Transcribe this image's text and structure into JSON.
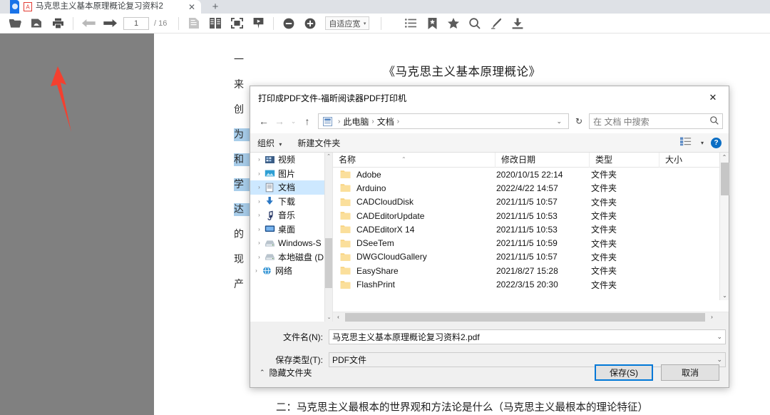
{
  "browser": {
    "tab": {
      "title": "马克思主义基本原理概论复习资料2",
      "favicon": "pdf-file-icon",
      "close_label": "✕"
    },
    "new_tab_label": "+"
  },
  "reader_toolbar": {
    "buttons": [
      {
        "name": "open-file-icon",
        "label": "open"
      },
      {
        "name": "cloud-open-icon",
        "label": "cloud"
      },
      {
        "name": "print-icon",
        "label": "print"
      },
      {
        "name": "previous-page-icon",
        "label": "prev"
      },
      {
        "name": "next-page-icon",
        "label": "next"
      }
    ],
    "page_number": "1",
    "page_total": "/ 16",
    "view_buttons": [
      {
        "name": "single-page-icon",
        "label": "single"
      },
      {
        "name": "two-page-icon",
        "label": "double"
      },
      {
        "name": "fit-page-icon",
        "label": "fit"
      },
      {
        "name": "presentation-icon",
        "label": "present"
      }
    ],
    "zoom_out_label": "−",
    "zoom_in_label": "+",
    "zoom_level": "自适应宽",
    "zoom_caret": "▾",
    "right_buttons": [
      {
        "name": "outline-list-icon",
        "label": "outline"
      },
      {
        "name": "bookmark-icon",
        "label": "bookmark"
      },
      {
        "name": "favorite-star-icon",
        "label": "star"
      },
      {
        "name": "search-icon",
        "label": "search"
      },
      {
        "name": "highlight-pen-icon",
        "label": "highlight"
      },
      {
        "name": "download-icon",
        "label": "download"
      }
    ]
  },
  "pdf_page": {
    "title": "《马克思主义基本原理概论》",
    "bottom_heading": "二：马克思主义最根本的世界观和方法论是什么（马克思主义最根本的理论特征）",
    "edge_chars": [
      {
        "char": "一",
        "highlighted": false
      },
      {
        "char": "来",
        "highlighted": false
      },
      {
        "char": "创",
        "highlighted": false
      },
      {
        "char": "为",
        "highlighted": true
      },
      {
        "char": "和",
        "highlighted": true
      },
      {
        "char": "学",
        "highlighted": true
      },
      {
        "char": "达",
        "highlighted": true
      },
      {
        "char": "的",
        "highlighted": false
      },
      {
        "char": "现",
        "highlighted": false
      },
      {
        "char": "产",
        "highlighted": false
      }
    ]
  },
  "annotation": {
    "arrow_color": "#f4402f",
    "name": "red-pointer-arrow"
  },
  "save_dialog": {
    "title": "打印成PDF文件-福昕阅读器PDF打印机",
    "close_label": "✕",
    "nav": {
      "back_label": "←",
      "forward_label": "→",
      "recent_label": "⌄",
      "up_label": "↑",
      "address_icon": "folder-location-icon",
      "breadcrumbs": [
        "此电脑",
        "文档"
      ],
      "separator": "›",
      "address_caret": "⌄",
      "refresh_label": "↻",
      "search_placeholder": "在 文档 中搜索",
      "search_icon": "search-icon"
    },
    "command_bar": {
      "organize_label": "组织",
      "organize_caret": "▾",
      "new_folder_label": "新建文件夹",
      "view_icon": "view-options-icon",
      "view_caret": "▾",
      "help_label": "?"
    },
    "tree": {
      "items": [
        {
          "label": "视频",
          "icon": "video-folder-icon",
          "selected": false,
          "expander": "›"
        },
        {
          "label": "图片",
          "icon": "pictures-folder-icon",
          "selected": false,
          "expander": "›"
        },
        {
          "label": "文档",
          "icon": "documents-folder-icon",
          "selected": true,
          "expander": "›"
        },
        {
          "label": "下载",
          "icon": "downloads-folder-icon",
          "selected": false,
          "expander": "›"
        },
        {
          "label": "音乐",
          "icon": "music-folder-icon",
          "selected": false,
          "expander": "›"
        },
        {
          "label": "桌面",
          "icon": "desktop-folder-icon",
          "selected": false,
          "expander": "›"
        },
        {
          "label": "Windows-S",
          "icon": "local-disk-icon",
          "selected": false,
          "expander": "›"
        },
        {
          "label": "本地磁盘 (D:",
          "icon": "local-disk-icon",
          "selected": false,
          "expander": "›"
        },
        {
          "label": "网络",
          "icon": "network-icon",
          "selected": false,
          "expander": "›"
        }
      ],
      "scroll_up": "⌃",
      "scroll_down": "⌄"
    },
    "file_list": {
      "columns": [
        "名称",
        "修改日期",
        "类型",
        "大小"
      ],
      "sort_indicator": "⌃",
      "rows": [
        {
          "name": "Adobe",
          "date": "2020/10/15 22:14",
          "type": "文件夹",
          "size": ""
        },
        {
          "name": "Arduino",
          "date": "2022/4/22 14:57",
          "type": "文件夹",
          "size": ""
        },
        {
          "name": "CADCloudDisk",
          "date": "2021/11/5 10:57",
          "type": "文件夹",
          "size": ""
        },
        {
          "name": "CADEditorUpdate",
          "date": "2021/11/5 10:53",
          "type": "文件夹",
          "size": ""
        },
        {
          "name": "CADEditorX 14",
          "date": "2021/11/5 10:53",
          "type": "文件夹",
          "size": ""
        },
        {
          "name": "DSeeTem",
          "date": "2021/11/5 10:59",
          "type": "文件夹",
          "size": ""
        },
        {
          "name": "DWGCloudGallery",
          "date": "2021/11/5 10:57",
          "type": "文件夹",
          "size": ""
        },
        {
          "name": "EasyShare",
          "date": "2021/8/27 15:28",
          "type": "文件夹",
          "size": ""
        },
        {
          "name": "FlashPrint",
          "date": "2022/3/15 20:30",
          "type": "文件夹",
          "size": ""
        }
      ],
      "vscroll_up": "⌃",
      "vscroll_down": "⌄",
      "hscroll_left": "‹",
      "hscroll_right": "›"
    },
    "filename_label": "文件名(N):",
    "filename_value": "马克思主义基本原理概论复习资料2.pdf",
    "filetype_label": "保存类型(T):",
    "filetype_value": "PDF文件",
    "combo_caret": "⌄",
    "hide_folders_label": "隐藏文件夹",
    "hide_folders_caret": "⌃",
    "save_button": "保存(S)",
    "cancel_button": "取消"
  }
}
